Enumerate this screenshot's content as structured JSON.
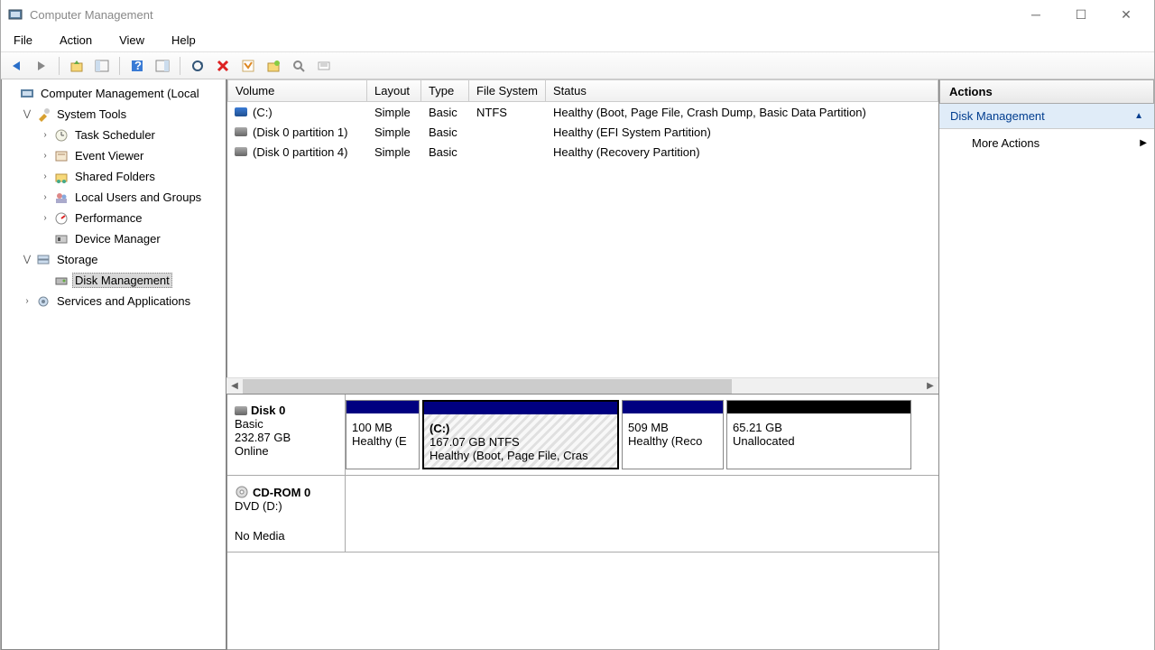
{
  "window": {
    "title": "Computer Management"
  },
  "menu": {
    "file": "File",
    "action": "Action",
    "view": "View",
    "help": "Help"
  },
  "tree": {
    "root": "Computer Management (Local",
    "systools": "System Tools",
    "tasksched": "Task Scheduler",
    "eventviewer": "Event Viewer",
    "sharedfolders": "Shared Folders",
    "localusers": "Local Users and Groups",
    "performance": "Performance",
    "devicemgr": "Device Manager",
    "storage": "Storage",
    "diskmgmt": "Disk Management",
    "services": "Services and Applications"
  },
  "columns": {
    "volume": "Volume",
    "layout": "Layout",
    "type": "Type",
    "fs": "File System",
    "status": "Status"
  },
  "volumes": [
    {
      "name": "(C:)",
      "layout": "Simple",
      "type": "Basic",
      "fs": "NTFS",
      "status": "Healthy (Boot, Page File, Crash Dump, Basic Data Partition)",
      "icon": "blue"
    },
    {
      "name": "(Disk 0 partition 1)",
      "layout": "Simple",
      "type": "Basic",
      "fs": "",
      "status": "Healthy (EFI System Partition)",
      "icon": "gray"
    },
    {
      "name": "(Disk 0 partition 4)",
      "layout": "Simple",
      "type": "Basic",
      "fs": "",
      "status": "Healthy (Recovery Partition)",
      "icon": "gray"
    }
  ],
  "disk0": {
    "name": "Disk 0",
    "type": "Basic",
    "size": "232.87 GB",
    "status": "Online",
    "p1": {
      "size": "100 MB",
      "status": "Healthy (E"
    },
    "p2": {
      "name": "(C:)",
      "size": "167.07 GB NTFS",
      "status": "Healthy (Boot, Page File, Cras"
    },
    "p3": {
      "size": "509 MB",
      "status": "Healthy (Reco"
    },
    "p4": {
      "size": "65.21 GB",
      "status": "Unallocated"
    }
  },
  "cdrom": {
    "name": "CD-ROM 0",
    "type": "DVD (D:)",
    "status": "No Media"
  },
  "actions": {
    "title": "Actions",
    "section": "Disk Management",
    "more": "More Actions"
  }
}
